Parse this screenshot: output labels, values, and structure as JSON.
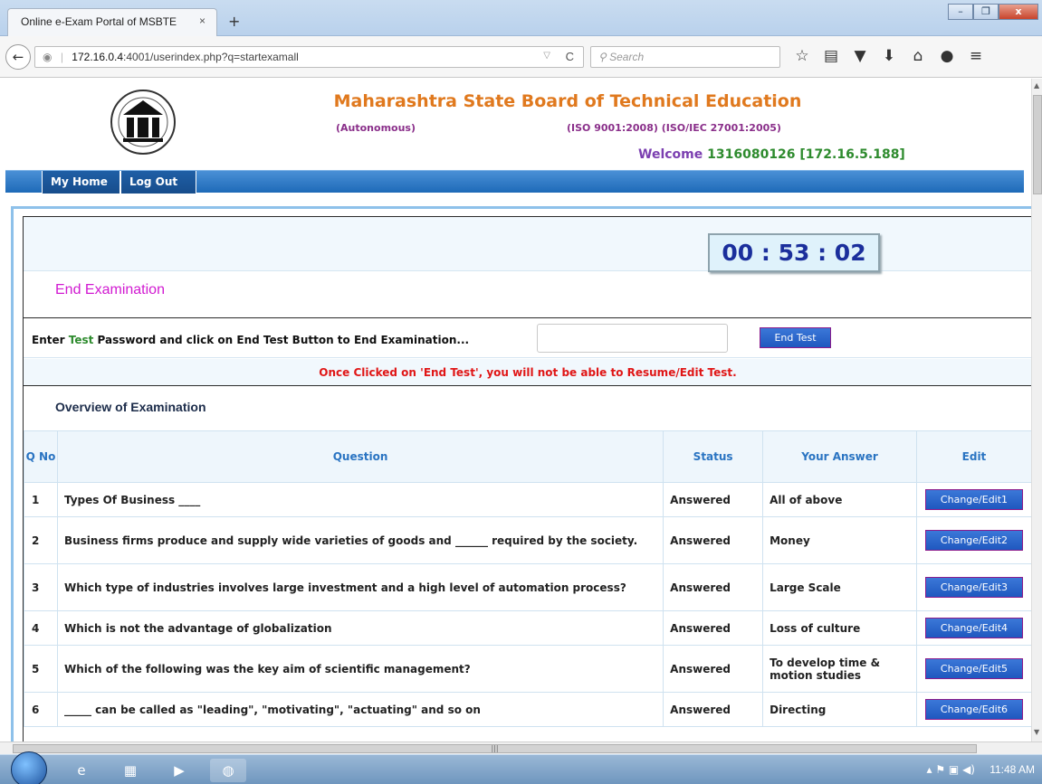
{
  "browser": {
    "tab_title": "Online e-Exam Portal of MSBTE",
    "tab_close": "×",
    "new_tab": "+",
    "url_host": "172.16.0.4",
    "url_rest": ":4001/userindex.php?q=startexamall",
    "search_placeholder": "Search",
    "win_min": "–",
    "win_max": "❐",
    "win_close": "x"
  },
  "header": {
    "org_title": "Maharashtra State Board of Technical Education",
    "autonomous": "(Autonomous)",
    "iso": "(ISO 9001:2008) (ISO/IEC 27001:2005)",
    "welcome_label": "Welcome",
    "welcome_user": "1316080126 [172.16.5.188]"
  },
  "menu": {
    "home": "My Home",
    "logout": "Log Out"
  },
  "exam": {
    "timer": "00 : 53 : 02",
    "end_heading": "End Examination",
    "pwd_label_pre": "Enter",
    "pwd_label_green": "Test",
    "pwd_label_post": "Password and click on End Test Button to End Examination...",
    "end_button": "End Test",
    "warning": "Once Clicked on 'End Test', you will not be able to Resume/Edit Test.",
    "overview_heading": "Overview of Examination"
  },
  "table": {
    "headers": {
      "qno": "Q No",
      "question": "Question",
      "status": "Status",
      "answer": "Your Answer",
      "edit": "Edit"
    },
    "rows": [
      {
        "no": "1",
        "question": "Types Of Business ____",
        "status": "Answered",
        "answer": "All of above",
        "edit": "Change/Edit1"
      },
      {
        "no": "2",
        "question": "  Business firms produce and supply wide varieties of goods and ______ required by the society.",
        "status": "Answered",
        "answer": "Money",
        "edit": "Change/Edit2"
      },
      {
        "no": "3",
        "question": "Which type of industries involves large investment and a high level of automation process?",
        "status": "Answered",
        "answer": "Large Scale",
        "edit": "Change/Edit3"
      },
      {
        "no": "4",
        "question": "Which is not the advantage of globalization",
        "status": "Answered",
        "answer": "Loss of culture",
        "edit": "Change/Edit4"
      },
      {
        "no": "5",
        "question": "Which of the following was the key aim of scientific management?",
        "status": "Answered",
        "answer": "To develop time & motion studies",
        "edit": "Change/Edit5"
      },
      {
        "no": "6",
        "question": "_____ can be called as \"leading\", \"motivating\", \"actuating\" and so on",
        "status": "Answered",
        "answer": "Directing",
        "edit": "Change/Edit6"
      }
    ]
  },
  "taskbar": {
    "clock": "11:48 AM"
  },
  "colors": {
    "accent_blue": "#1e6ab8",
    "title_orange": "#e0791e",
    "heading_magenta": "#d11ad1",
    "warning_red": "#e01616"
  }
}
